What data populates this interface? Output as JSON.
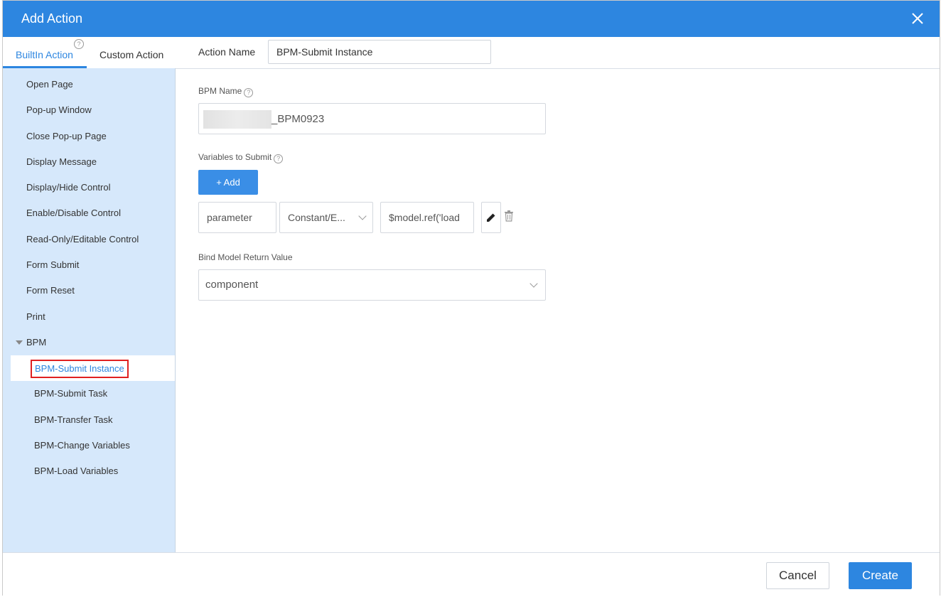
{
  "dialog": {
    "title": "Add Action"
  },
  "tabs": {
    "builtin": "BuiltIn Action",
    "custom": "Custom Action",
    "help": "?"
  },
  "sidebar": {
    "items": [
      {
        "label": "Open Page"
      },
      {
        "label": "Pop-up Window"
      },
      {
        "label": "Close Pop-up Page"
      },
      {
        "label": "Display Message"
      },
      {
        "label": "Display/Hide Control"
      },
      {
        "label": "Enable/Disable Control"
      },
      {
        "label": "Read-Only/Editable Control"
      },
      {
        "label": "Form Submit"
      },
      {
        "label": "Form Reset"
      },
      {
        "label": "Print"
      },
      {
        "label": "BPM"
      },
      {
        "label": "BPM-Submit Instance"
      },
      {
        "label": "BPM-Submit Task"
      },
      {
        "label": "BPM-Transfer Task"
      },
      {
        "label": "BPM-Change Variables"
      },
      {
        "label": "BPM-Load Variables"
      }
    ]
  },
  "action_name": {
    "label": "Action Name",
    "value": "BPM-Submit Instance"
  },
  "form": {
    "bpm_name_label": "BPM Name",
    "bpm_name_value": "_BPM0923",
    "variables_label": "Variables to Submit",
    "add_label": "+ Add",
    "variable_param": "parameter",
    "variable_type": "Constant/E...",
    "variable_value": "$model.ref('load",
    "return_label": "Bind Model Return Value",
    "return_value": "component",
    "help": "?"
  },
  "footer": {
    "cancel": "Cancel",
    "create": "Create"
  },
  "colors": {
    "accent": "#2d86e0",
    "sidebar_bg": "#d6e8fb",
    "highlight_border": "#e02020"
  }
}
